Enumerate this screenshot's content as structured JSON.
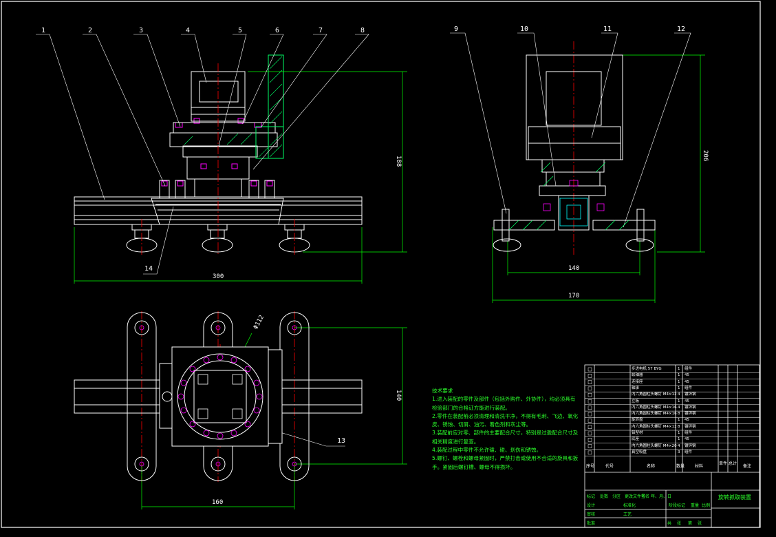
{
  "colors": {
    "background": "#000000",
    "outline": "#ffffff",
    "dimension": "#00ff00",
    "centerline": "#ff0000",
    "hatch": "#00ff66",
    "bolt": "#ff00ff",
    "part": "#00ffff",
    "notes": "#2bff2b"
  },
  "callouts": [
    "1",
    "2",
    "3",
    "4",
    "5",
    "6",
    "7",
    "8",
    "9",
    "10",
    "11",
    "12",
    "13",
    "14"
  ],
  "dimensions": {
    "front_height": "188",
    "front_width": "300",
    "side_height": "206",
    "side_inner": "140",
    "side_width": "170",
    "top_height": "140",
    "top_width": "160",
    "top_diameter": "Φ112"
  },
  "notes": {
    "heading": "技术要求",
    "lines": [
      "1.进入装配的零件及部件（包括外购件、外协件），均必须具有",
      "检验部门的合格证方能进行装配。",
      "2.零件在装配前必须清理和清洗干净，不得有毛刺、飞边、氧化",
      "皮、锈蚀、切屑、油污、着色剂和灰尘等。",
      "3.装配前应对零、部件的主要配合尺寸，特别是过盈配合尺寸及",
      "相关精度进行复查。",
      "4.装配过程中零件不允许磕、碰、划伤和锈蚀。",
      "5.螺钉、螺栓和螺母紧固时，严禁打击或使用不合适的旋具和扳",
      "手。紧固后螺钉槽、螺母不得损坏。"
    ]
  },
  "title_block": {
    "header": [
      "序号",
      "代号",
      "名称",
      "数量",
      "材料",
      "单件",
      "总计",
      "备注"
    ],
    "rows": [
      {
        "qty": "1",
        "desc": "步进电机 57 BYG",
        "mat": "组件"
      },
      {
        "qty": "1",
        "desc": "联轴器",
        "mat": "45"
      },
      {
        "qty": "1",
        "desc": "连接座",
        "mat": "45"
      },
      {
        "qty": "1",
        "desc": "轴承",
        "mat": "组件"
      },
      {
        "qty": "4",
        "desc": "内六角圆柱头螺钉 M4×12",
        "mat": "镀锌钢"
      },
      {
        "qty": "1",
        "desc": "立板",
        "mat": "45"
      },
      {
        "qty": "4",
        "desc": "内六角圆柱头螺钉 M4×16",
        "mat": "镀锌钢"
      },
      {
        "qty": "8",
        "desc": "内六角圆柱头螺钉 M4×16",
        "mat": "镀锌钢"
      },
      {
        "qty": "1",
        "desc": "旋转盘",
        "mat": "45"
      },
      {
        "qty": "8",
        "desc": "内六角圆柱头螺钉 M4×12",
        "mat": "镀锌钢"
      },
      {
        "qty": "1",
        "desc": "铝型材",
        "mat": "组件"
      },
      {
        "qty": "1",
        "desc": "底座",
        "mat": "45"
      },
      {
        "qty": "4",
        "desc": "内六角圆柱头螺钉 M4×20",
        "mat": "镀锌钢"
      },
      {
        "qty": "3",
        "desc": "真空吸盘",
        "mat": "组件"
      }
    ],
    "title": "旋转抓取装置",
    "footer": [
      "标记",
      "处数",
      "分区",
      "更改文件号",
      "签名",
      "年、月、日",
      "设计",
      "标准化",
      "阶段标记",
      "重量",
      "比例",
      "审核",
      "工艺",
      "批准",
      "共",
      "张",
      "第",
      "张"
    ]
  }
}
